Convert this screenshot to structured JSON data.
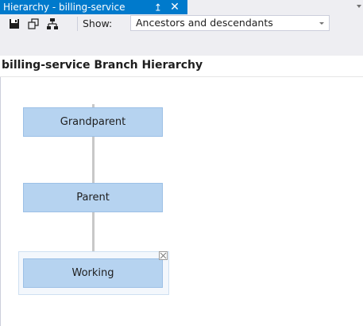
{
  "tab": {
    "title": "Hierarchy - billing-service",
    "pin_glyph": "↤",
    "close_glyph": "✕"
  },
  "toolbar": {
    "save_icon": "save-icon",
    "copy_icon": "copy-icon",
    "layout_icon": "hierarchy-layout-icon",
    "show_label": "Show:",
    "show_value": "Ancestors and descendants"
  },
  "page": {
    "title": "billing-service Branch Hierarchy"
  },
  "hierarchy": {
    "nodes": [
      {
        "label": "Grandparent"
      },
      {
        "label": "Parent"
      },
      {
        "label": "Working"
      }
    ]
  },
  "colors": {
    "accent": "#007acc",
    "node_fill": "#b6d3f0",
    "connector": "#c8c8c8"
  }
}
